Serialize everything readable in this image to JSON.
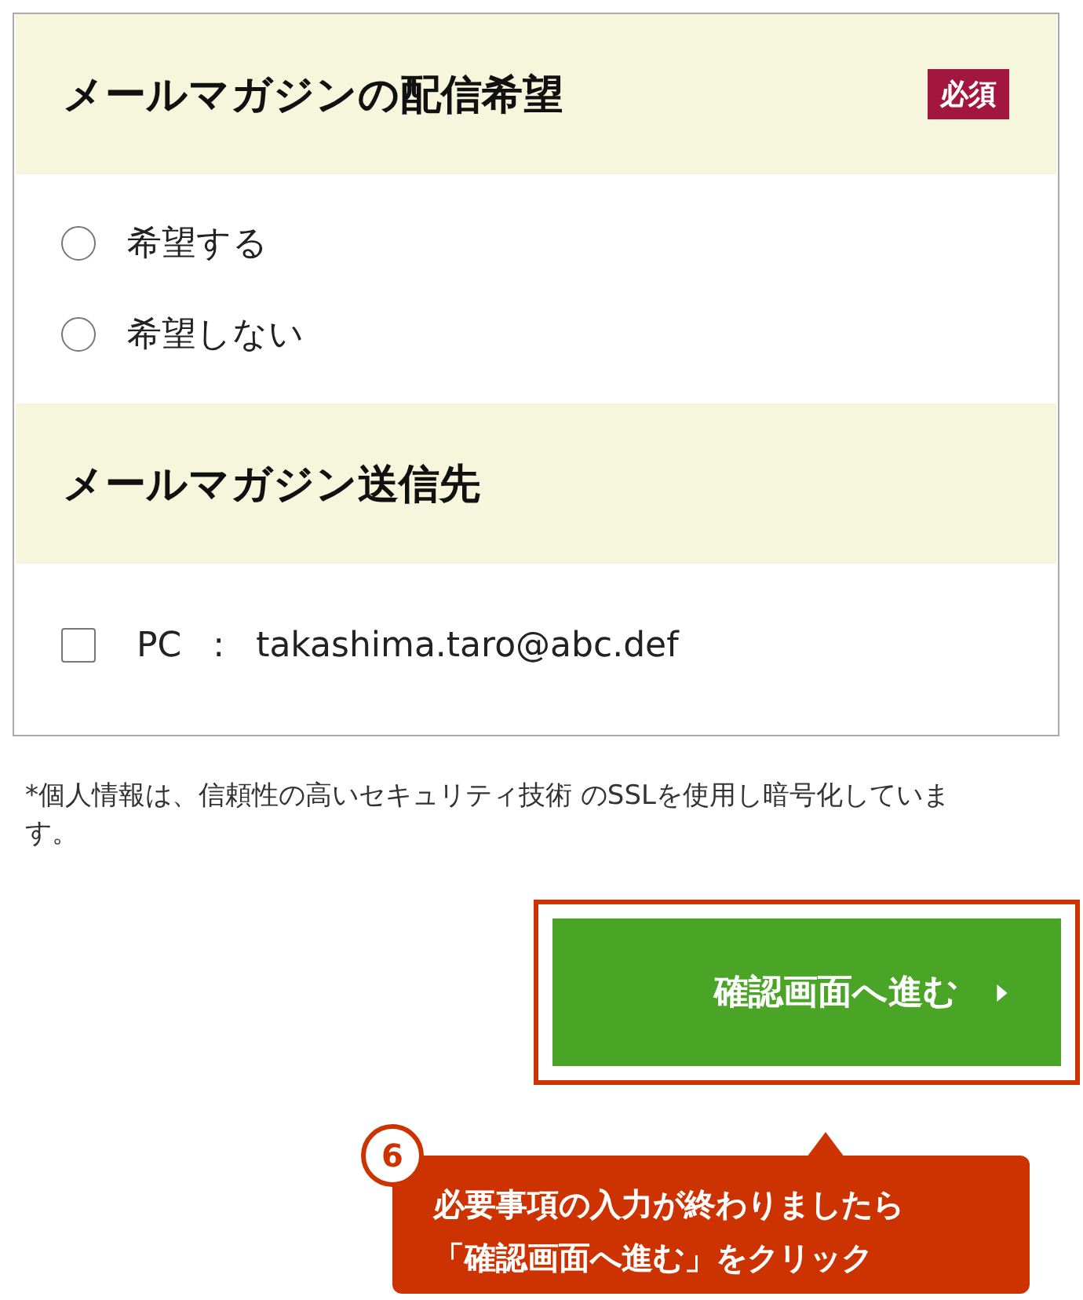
{
  "sections": [
    {
      "heading": "メールマガジンの配信希望",
      "required_badge": "必須",
      "kind": "radio",
      "options": [
        {
          "label": "希望する",
          "selected": false
        },
        {
          "label": "希望しない",
          "selected": false
        }
      ]
    },
    {
      "heading": "メールマガジン送信先",
      "kind": "checkbox",
      "options": [
        {
          "label": "PC",
          "separator": ":",
          "value": "takashima.taro@abc.def",
          "checked": false
        }
      ]
    }
  ],
  "note": "*個人情報は、信頼性の高いセキュリティ技術 のSSLを使用し暗号化しています。",
  "confirm_button": {
    "label": "確認画面へ進む",
    "highlighted": true
  },
  "callout": {
    "step": "6",
    "lines": [
      "必要事項の入力が終わりましたら",
      "「確認画面へ進む」をクリック"
    ]
  }
}
